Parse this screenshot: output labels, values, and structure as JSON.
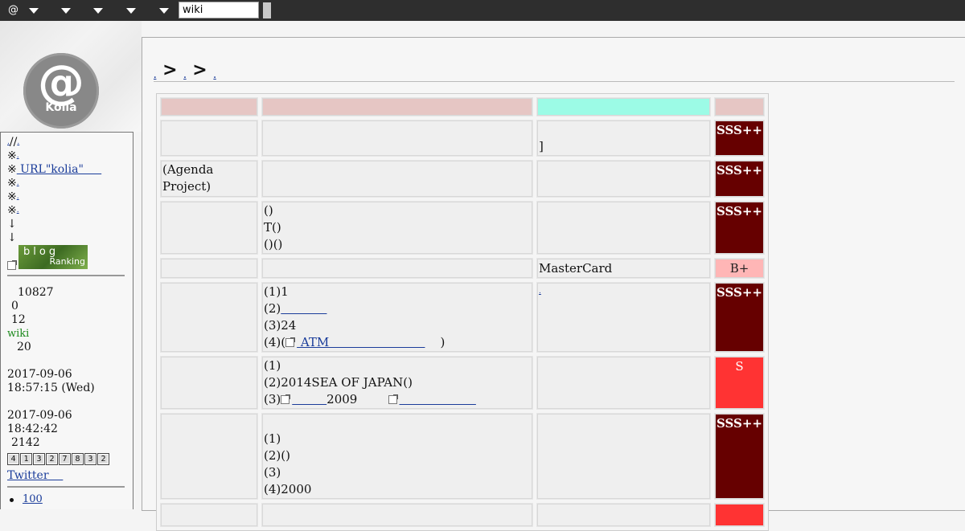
{
  "topbar": {
    "at_label": "@",
    "menus": [
      "",
      "",
      "",
      "",
      ""
    ],
    "search_value": "wiki"
  },
  "logo": {
    "symbol": "@",
    "text": "Kolia"
  },
  "sidebar": {
    "lines": [
      {
        "prefix": "",
        "text": "//",
        "link": ""
      },
      {
        "prefix": "※",
        "text": "",
        "link": ""
      },
      {
        "prefix": "※",
        "text": "",
        "link": " URL\"kolia\"     "
      },
      {
        "prefix": "※",
        "text": "",
        "link": ""
      },
      {
        "prefix": "※",
        "text": "",
        "link": ""
      },
      {
        "prefix": "※",
        "text": "",
        "link": ""
      },
      {
        "prefix": "↓",
        "text": "",
        "link": ""
      },
      {
        "prefix": "↓",
        "text": "",
        "link": ""
      }
    ],
    "blog_ranking": {
      "line1": "blog",
      "line2": "Ranking"
    },
    "stats": [
      "10827",
      "0",
      "12"
    ],
    "wiki_label": "wiki",
    "stat_20": "20",
    "updated_date": "2017-09-06",
    "updated_time": "18:57:15 (Wed)",
    "date2": "2017-09-06",
    "time2": "18:42:42",
    "count2": "2142",
    "counter_digits": [
      "4",
      "1",
      "3",
      "2",
      "7",
      "8",
      "3",
      "2"
    ],
    "twitter_label": "Twitter",
    "list_item_1": "100"
  },
  "breadcrumb": {
    "sep1": ">",
    "sep2": ">"
  },
  "table": {
    "rows": [
      {
        "c1": [
          ""
        ],
        "c2": [
          ""
        ],
        "c3": [
          "",
          "]"
        ],
        "grade": "SSS++",
        "level": "sss"
      },
      {
        "c1": [
          "(Agenda Project)"
        ],
        "c2": [
          ""
        ],
        "c3": [
          ""
        ],
        "grade": "SSS++",
        "level": "sss"
      },
      {
        "c1": [
          ""
        ],
        "c2": [
          "()",
          "T()",
          "()()"
        ],
        "c3": [
          ""
        ],
        "grade": "SSS++",
        "level": "sss"
      },
      {
        "c1": [
          ""
        ],
        "c2": [
          ""
        ],
        "c3": [
          "MasterCard"
        ],
        "grade": "B+",
        "level": "b"
      },
      {
        "c1": [
          ""
        ],
        "c2": [
          "(1)1",
          "(2)",
          "(3)24",
          "(4)("
        ],
        "c3": [
          ""
        ],
        "grade": "SSS++",
        "level": "sss"
      },
      {
        "c1": [
          ""
        ],
        "c2": [
          "(1)",
          "(2)2014SEA OF JAPAN()",
          "(3)"
        ],
        "c3": [
          ""
        ],
        "grade": "S",
        "level": "s"
      },
      {
        "c1": [
          ""
        ],
        "c2": [
          "(1)",
          "(2)()",
          "(3)",
          "(4)2000"
        ],
        "c3": [
          ""
        ],
        "grade": "SSS++",
        "level": "sss"
      }
    ],
    "links": {
      "r5_line2": "            ",
      "r5_atm": " ATM                         ",
      "r5_close": ")",
      "r6_link1": "         ",
      "r6_2009": "2009",
      "r6_link2": "                    "
    }
  }
}
